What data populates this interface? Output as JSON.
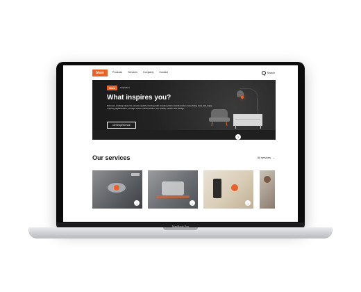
{
  "device": {
    "model_label": "MacBook Pro"
  },
  "site": {
    "logo_text": "blum",
    "nav": [
      {
        "label": "Products"
      },
      {
        "label": "Services"
      },
      {
        "label": "Company"
      },
      {
        "label": "Contact"
      }
    ],
    "search_label": "Search"
  },
  "hero": {
    "badge": "blum",
    "badge_caption": "inspiration",
    "title": "What inspires you?",
    "text": "Discover exciting ideas for a better quality of living with creative planer solutions for every living area and enjoy ongoing digitalization, storage space maximization, top-quality motion and design.",
    "button": "Get inspired now"
  },
  "services": {
    "title": "Our services",
    "all_link": "All services"
  },
  "help_label": "?"
}
